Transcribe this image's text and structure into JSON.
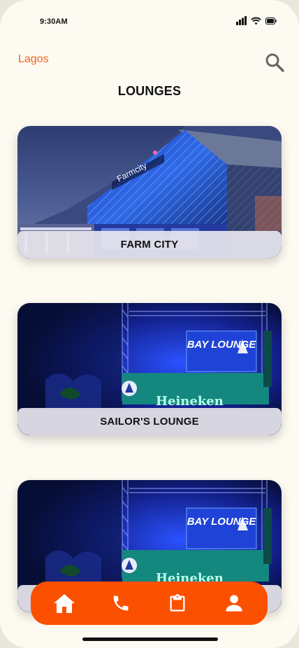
{
  "status_bar": {
    "time": "9:30AM"
  },
  "header": {
    "location": "Lagos",
    "title": "LOUNGES"
  },
  "lounges": [
    {
      "name": "FARM CITY",
      "sign": "Farmcity"
    },
    {
      "name": "SAILOR'S LOUNGE",
      "sign": "BAY LOUNGE",
      "banner": "Heineken"
    },
    {
      "name": "",
      "sign": "BAY LOUNGE",
      "banner": "Heineken"
    }
  ],
  "icons": {
    "signal": "signal-icon",
    "wifi": "wifi-icon",
    "battery": "battery-icon",
    "search": "search-icon",
    "home": "home-icon",
    "phone": "phone-icon",
    "clipboard": "clipboard-icon",
    "profile": "profile-icon"
  },
  "colors": {
    "accent": "#fa5000",
    "location_text": "#f26322",
    "background": "#fdfaf1"
  }
}
